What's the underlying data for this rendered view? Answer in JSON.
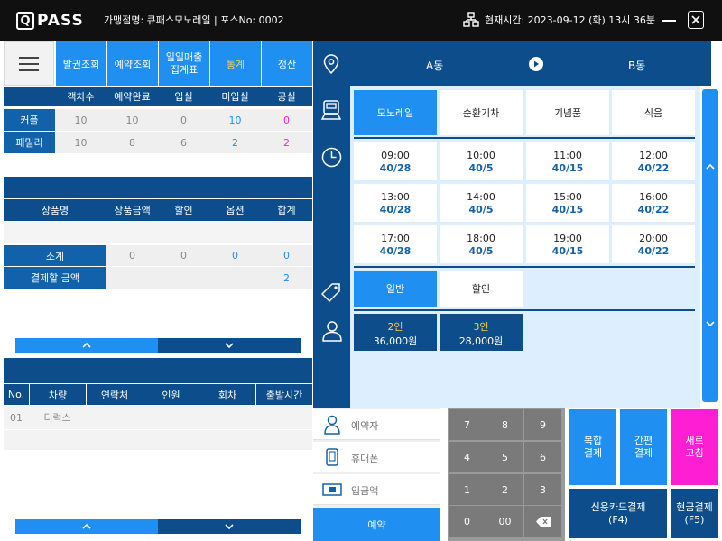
{
  "app": {
    "logo_text": "PASS",
    "store_info": "가맹점명: 큐패스모노레일 | 포스No: 0002",
    "datetime": "현재시간: 2023-09-12 (화) 13시 36분"
  },
  "nav": {
    "tabs": [
      {
        "label": "발권조회"
      },
      {
        "label": "예약조회"
      },
      {
        "label": "일일매출 집계표"
      },
      {
        "label": "통계"
      },
      {
        "label": "정산"
      }
    ]
  },
  "status": {
    "columns": [
      "객차수",
      "예약완료",
      "입실",
      "미입실",
      "공실"
    ],
    "rows": [
      {
        "label": "커플",
        "values": [
          "10",
          "10",
          "0",
          "10",
          "0"
        ]
      },
      {
        "label": "패밀리",
        "values": [
          "10",
          "8",
          "6",
          "2",
          "2"
        ]
      }
    ]
  },
  "products": {
    "columns": [
      "상품명",
      "상품금액",
      "할인",
      "옵션",
      "합계"
    ],
    "subtotal_label": "소계",
    "subtotal_values": [
      "0",
      "0",
      "0",
      "0"
    ],
    "payable_label": "결제할 금액",
    "payable_value": "2"
  },
  "reservations": {
    "columns": [
      "No.",
      "차량",
      "연락처",
      "인원",
      "회차",
      "출발시간"
    ],
    "rows": [
      {
        "no": "01",
        "vehicle": "디럭스",
        "contact": "",
        "people": "",
        "round": "",
        "departure": ""
      }
    ]
  },
  "route": {
    "from": "A동",
    "to": "B동"
  },
  "categories": [
    {
      "label": "모노레일"
    },
    {
      "label": "순환기차"
    },
    {
      "label": "기념품"
    },
    {
      "label": "식음"
    }
  ],
  "timeslots": [
    {
      "time": "09:00",
      "seats": "40/28"
    },
    {
      "time": "10:00",
      "seats": "40/5"
    },
    {
      "time": "11:00",
      "seats": "40/15"
    },
    {
      "time": "12:00",
      "seats": "40/22"
    },
    {
      "time": "13:00",
      "seats": "40/28"
    },
    {
      "time": "14:00",
      "seats": "40/5"
    },
    {
      "time": "15:00",
      "seats": "40/15"
    },
    {
      "time": "16:00",
      "seats": "40/22"
    },
    {
      "time": "17:00",
      "seats": "40/28"
    },
    {
      "time": "18:00",
      "seats": "40/5"
    },
    {
      "time": "19:00",
      "seats": "40/15"
    },
    {
      "time": "20:00",
      "seats": "40/22"
    }
  ],
  "fare_types": [
    {
      "label": "일반"
    },
    {
      "label": "할인"
    }
  ],
  "prices": [
    {
      "people": "2인",
      "amount": "36,000원"
    },
    {
      "people": "3인",
      "amount": "28,000원"
    }
  ],
  "form": {
    "reserver_placeholder": "예약자",
    "phone_placeholder": "휴대폰",
    "deposit_placeholder": "입금액",
    "reserve_label": "예약"
  },
  "keypad": [
    "7",
    "8",
    "9",
    "4",
    "5",
    "6",
    "1",
    "2",
    "3",
    "0",
    "00"
  ],
  "payment": {
    "combined": "복합 결제",
    "simple": "간편 결제",
    "refresh": "새로 고침",
    "card": "신용카드결제 (F4)",
    "cash": "현금결제 (F5)"
  },
  "colors": {
    "primary": "#1f8ff2",
    "dark": "#0d4d8c",
    "accent_yellow": "#ffd24a",
    "accent_pink": "#ff1fd2"
  }
}
